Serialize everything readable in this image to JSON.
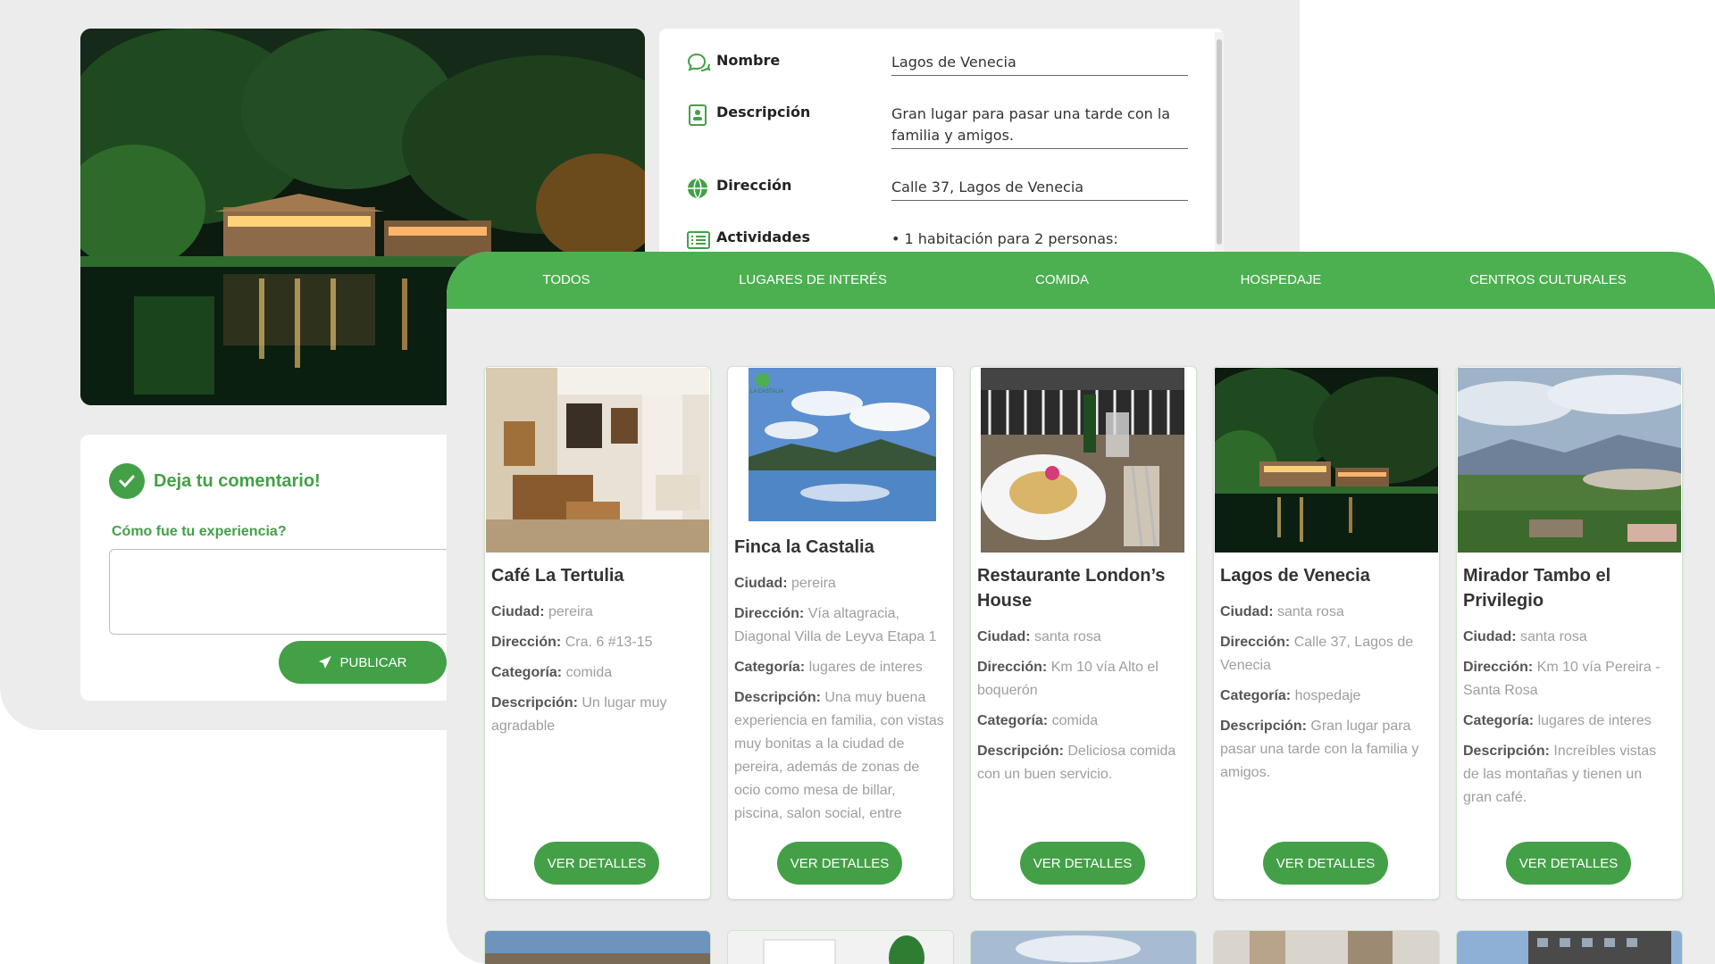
{
  "details": {
    "rows": [
      {
        "icon": "chat-icon",
        "label": "Nombre",
        "value": "Lagos de Venecia"
      },
      {
        "icon": "id-card-icon",
        "label": "Descripción",
        "value": "Gran lugar para pasar una tarde con la familia y amigos."
      },
      {
        "icon": "globe-icon",
        "label": "Dirección",
        "value": "Calle 37, Lagos de Venecia"
      },
      {
        "icon": "list-icon",
        "label": "Actividades",
        "value": "• 1 habitación para 2 personas:"
      }
    ]
  },
  "comment": {
    "title": "Deja tu comentario!",
    "question": "Cómo fue tu experiencia?",
    "input_value": "",
    "publish_label": "PUBLICAR"
  },
  "tabs": [
    "TODOS",
    "LUGARES DE INTERÉS",
    "COMIDA",
    "HOSPEDAJE",
    "CENTROS CULTURALES"
  ],
  "labels": {
    "ciudad": "Ciudad:",
    "direccion": "Dirección:",
    "categoria": "Categoría:",
    "descripcion": "Descripción:",
    "button": "VER DETALLES"
  },
  "cards": [
    {
      "title": "Café La Tertulia",
      "ciudad": "pereira",
      "direccion": "Cra. 6 #13-15",
      "categoria": "comida",
      "descripcion": "Un lugar muy agradable"
    },
    {
      "title": "Finca la Castalia",
      "ciudad": "pereira",
      "direccion": "Vía altagracia, Diagonal Villa de Leyva Etapa 1",
      "categoria": "lugares de interes",
      "descripcion": "Una muy buena experiencia en familia, con vistas muy bonitas a la ciudad de pereira, además de zonas de ocio como mesa de billar, piscina, salon social, entre"
    },
    {
      "title": "Restaurante London’s House",
      "ciudad": "santa rosa",
      "direccion": "Km 10 vía Alto el boquerón",
      "categoria": "comida",
      "descripcion": "Deliciosa comida con un buen servicio."
    },
    {
      "title": "Lagos de Venecia",
      "ciudad": "santa rosa",
      "direccion": "Calle 37, Lagos de Venecia",
      "categoria": "hospedaje",
      "descripcion": "Gran lugar para pasar una tarde con la familia y amigos."
    },
    {
      "title": "Mirador Tambo el Privilegio",
      "ciudad": "santa rosa",
      "direccion": "Km 10 vía Pereira - Santa Rosa",
      "categoria": "lugares de interes",
      "descripcion": "Increíbles vistas de las montañas y tienen un gran café."
    }
  ],
  "logo_text": "LA CASTALIA",
  "colors": {
    "accent": "#43a047",
    "tab_bar": "#4caf50",
    "panel": "#ececec"
  }
}
